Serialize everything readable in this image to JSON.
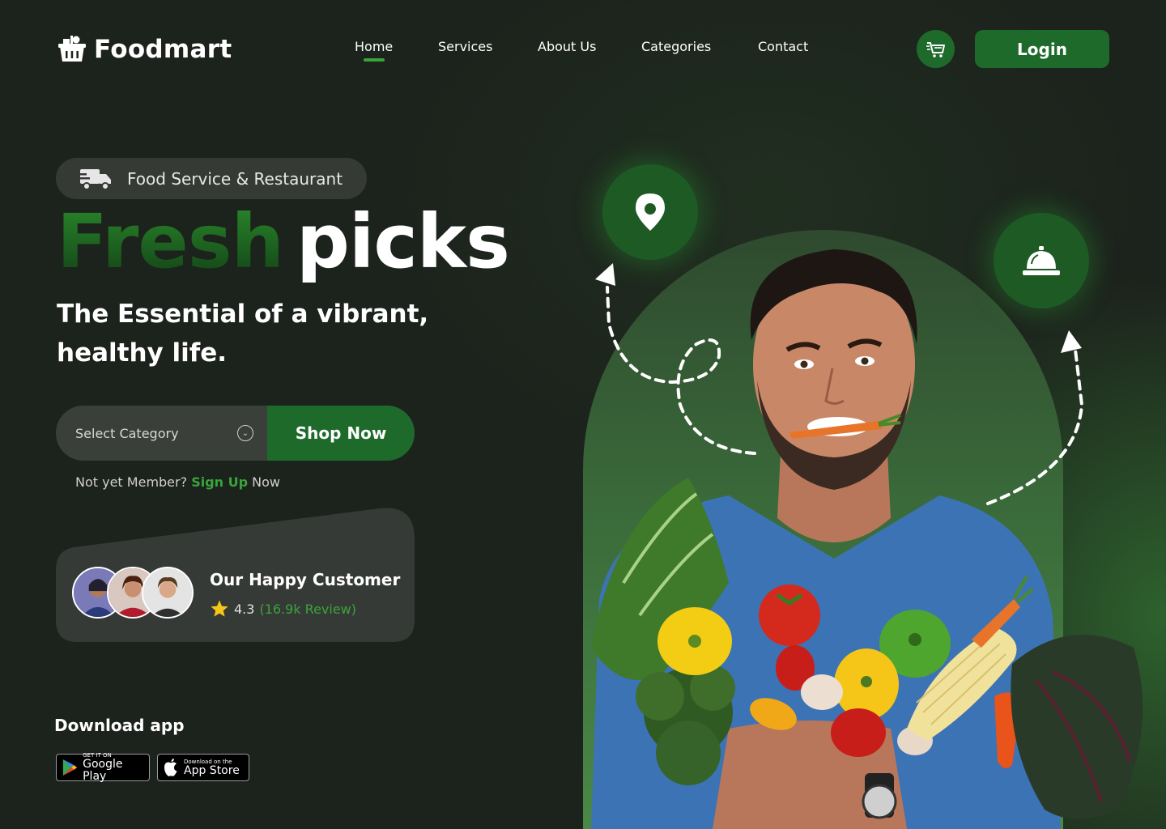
{
  "brand": {
    "name": "Foodmart"
  },
  "nav": {
    "items": [
      {
        "label": "Home",
        "active": true
      },
      {
        "label": "Services",
        "active": false
      },
      {
        "label": "About Us",
        "active": false
      },
      {
        "label": "Categories",
        "active": false
      },
      {
        "label": "Contact",
        "active": false
      }
    ],
    "cart_icon": "cart-icon",
    "login_label": "Login"
  },
  "hero": {
    "badge_label": "Food Service & Restaurant",
    "badge_icon": "delivery-truck-icon",
    "headline_accent": "Fresh",
    "headline_main": "picks",
    "subheadline": "The Essential of a vibrant, healthy life.",
    "category_placeholder": "Select Category",
    "shop_label": "Shop Now",
    "member_prefix": "Not yet Member?",
    "member_link": "Sign Up",
    "member_suffix": "Now"
  },
  "customers": {
    "title": "Our Happy Customer",
    "rating": "4.3",
    "reviews": "(16.9k Review)",
    "rating_value": 4.3
  },
  "download": {
    "title": "Download app",
    "google_small": "GET IT ON",
    "google_big": "Google Play",
    "apple_small": "Download on the",
    "apple_big": "App Store"
  },
  "colors": {
    "background": "#1c221c",
    "accent": "#1e6a2b",
    "accent_text": "#3ba33b"
  },
  "icons": [
    "location-pin-icon",
    "service-bell-icon",
    "star-icon",
    "chevron-down-icon"
  ]
}
